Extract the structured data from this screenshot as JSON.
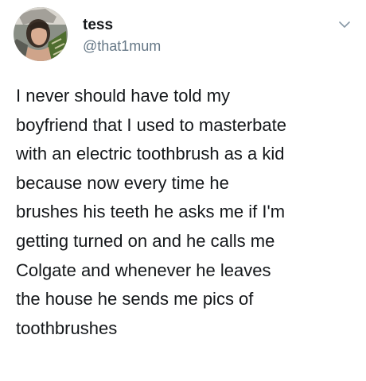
{
  "tweet": {
    "author": {
      "display_name": "tess",
      "handle": "@that1mum",
      "avatar_icon": "profile-photo",
      "menu_icon": "chevron-down-icon"
    },
    "text_lines": [
      "I never should have told my",
      "boyfriend that I used to masterbate",
      "with an electric toothbrush as a kid",
      "because now every time he",
      "brushes his teeth he asks me if I'm",
      "getting turned on and he calls me",
      "Colgate and whenever he leaves",
      "the house he sends me pics of",
      "toothbrushes"
    ]
  }
}
